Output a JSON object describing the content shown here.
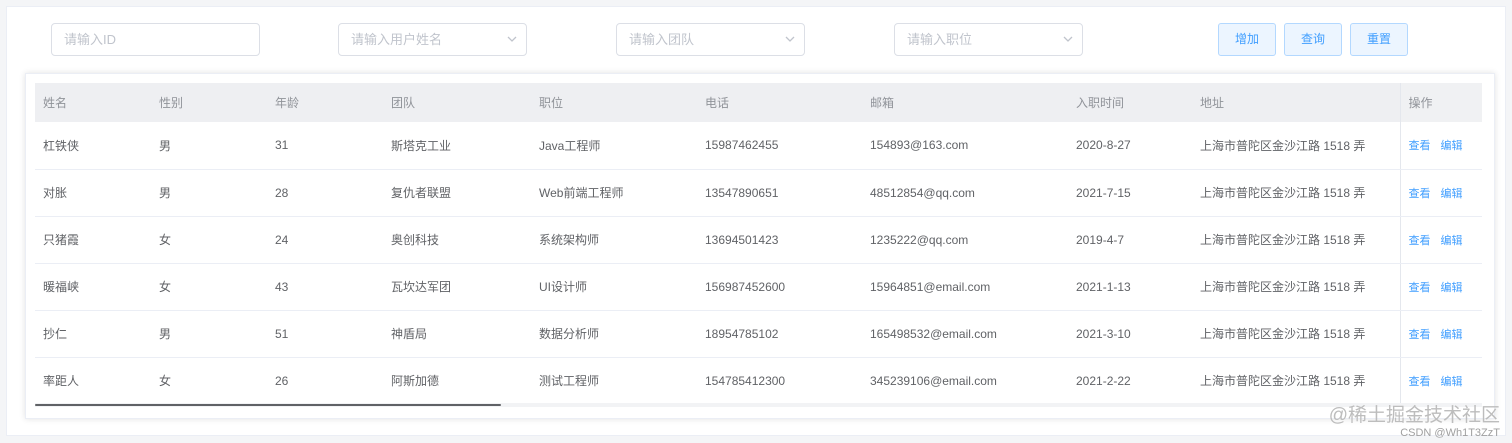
{
  "filters": {
    "id_placeholder": "请输入ID",
    "name_placeholder": "请输入用户姓名",
    "team_placeholder": "请输入团队",
    "position_placeholder": "请输入职位"
  },
  "buttons": {
    "add": "增加",
    "query": "查询",
    "reset": "重置"
  },
  "table": {
    "headers": [
      "姓名",
      "性别",
      "年龄",
      "团队",
      "职位",
      "电话",
      "邮箱",
      "入职时间",
      "地址",
      "操作"
    ],
    "rows": [
      [
        "杠铁侠",
        "男",
        "31",
        "斯塔克工业",
        "Java工程师",
        "15987462455",
        "154893@163.com",
        "2020-8-27",
        "上海市普陀区金沙江路 1518 弄"
      ],
      [
        "对胀",
        "男",
        "28",
        "复仇者联盟",
        "Web前端工程师",
        "13547890651",
        "48512854@qq.com",
        "2021-7-15",
        "上海市普陀区金沙江路 1518 弄"
      ],
      [
        "只猪霞",
        "女",
        "24",
        "奥创科技",
        "系统架构师",
        "13694501423",
        "1235222@qq.com",
        "2019-4-7",
        "上海市普陀区金沙江路 1518 弄"
      ],
      [
        "暖福峡",
        "女",
        "43",
        "瓦坎达军团",
        "UI设计师",
        "156987452600",
        "15964851@email.com",
        "2021-1-13",
        "上海市普陀区金沙江路 1518 弄"
      ],
      [
        "抄仁",
        "男",
        "51",
        "神盾局",
        "数据分析师",
        "18954785102",
        "165498532@email.com",
        "2021-3-10",
        "上海市普陀区金沙江路 1518 弄"
      ],
      [
        "率距人",
        "女",
        "26",
        "阿斯加德",
        "测试工程师",
        "154785412300",
        "345239106@email.com",
        "2021-2-22",
        "上海市普陀区金沙江路 1518 弄"
      ]
    ],
    "actions": {
      "view": "查看",
      "edit": "编辑"
    }
  },
  "watermark": {
    "main": "@稀土掘金技术社区",
    "sub": "CSDN @Wh1T3ZzT"
  },
  "colors": {
    "accent": "#409eff",
    "header_bg": "#eeeff2",
    "border": "#dcdfe6"
  }
}
